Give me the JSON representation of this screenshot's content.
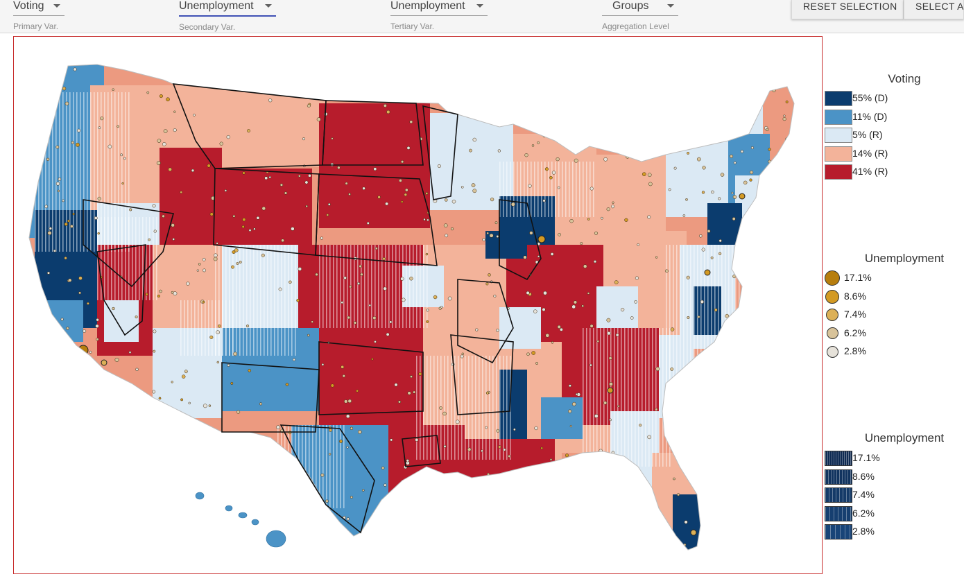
{
  "controls": {
    "primary": {
      "value": "Voting",
      "help": "Primary Var."
    },
    "secondary": {
      "value": "Unemployment",
      "help": "Secondary Var."
    },
    "tertiary": {
      "value": "Unemployment",
      "help": "Tertiary Var."
    },
    "aggregation": {
      "value": "Groups",
      "help": "Aggregation Level"
    }
  },
  "buttons": {
    "reset": "RESET SELECTION",
    "select_all": "SELECT AL"
  },
  "legends": {
    "voting": {
      "title": "Voting",
      "items": [
        {
          "label": "55% (D)",
          "color": "#0b3c6e"
        },
        {
          "label": "11% (D)",
          "color": "#4b93c6"
        },
        {
          "label": "5% (R)",
          "color": "#dbe9f4"
        },
        {
          "label": "14% (R)",
          "color": "#f3b39a"
        },
        {
          "label": "41% (R)",
          "color": "#b71c2c"
        }
      ]
    },
    "unemployment_circles": {
      "title": "Unemployment",
      "items": [
        {
          "label": "17.1%",
          "color": "#b77e0e"
        },
        {
          "label": "8.6%",
          "color": "#d39a24"
        },
        {
          "label": "7.4%",
          "color": "#dcb057"
        },
        {
          "label": "6.2%",
          "color": "#d8c39a"
        },
        {
          "label": "2.8%",
          "color": "#e6e2da"
        }
      ]
    },
    "unemployment_hatch": {
      "title": "Unemployment",
      "items": [
        {
          "label": "17.1%",
          "color": "#0e2a52",
          "density": 5
        },
        {
          "label": "8.6%",
          "color": "#12345f",
          "density": 4
        },
        {
          "label": "7.4%",
          "color": "#143a68",
          "density": 3
        },
        {
          "label": "6.2%",
          "color": "#163f70",
          "density": 2
        },
        {
          "label": "2.8%",
          "color": "#184478",
          "density": 1
        }
      ]
    }
  },
  "map": {
    "outline_color": "#111111",
    "border_color": "#c62828",
    "circle_stroke": "#3a2a10"
  }
}
